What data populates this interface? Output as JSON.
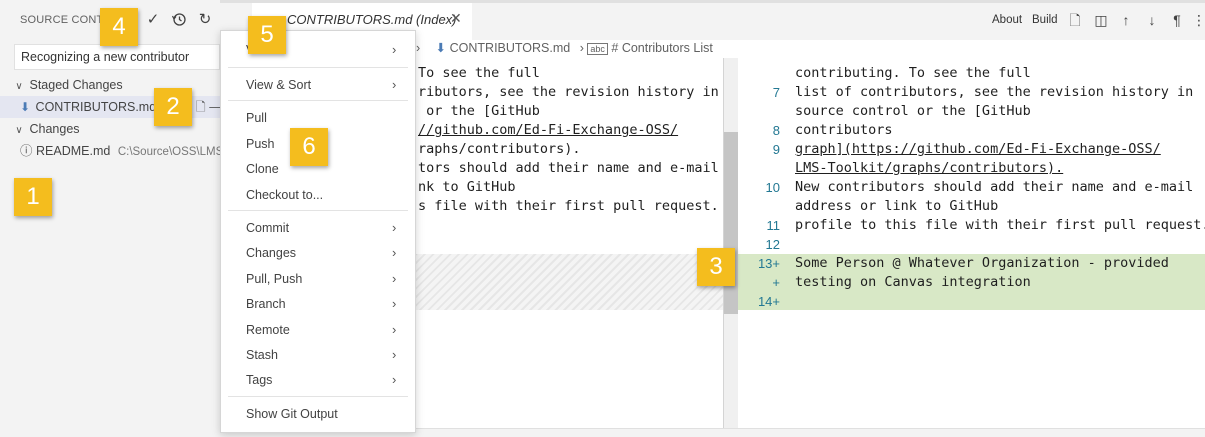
{
  "sidebar": {
    "title": "SOURCE CONTROL",
    "commit_message": "Recognizing a new contributor",
    "staged_group": "Staged Changes",
    "staged_file": "CONTRIBUTORS.md",
    "changes_group": "Changes",
    "changed_file": "README.md",
    "changed_file_path": "C:\\Source\\OSS\\LMS"
  },
  "tab": {
    "title": "CONTRIBUTORS.md (Index)"
  },
  "toolbar": {
    "about": "About",
    "build": "Build"
  },
  "breadcrumb": {
    "file": "CONTRIBUTORS.md",
    "symbol": "# Contributors List"
  },
  "left_editor": {
    "lines": [
      "To see the full",
      "ributors, see the revision history in",
      " or the [GitHub",
      "",
      "//github.com/Ed-Fi-Exchange-OSS/",
      "raphs/contributors).",
      "tors should add their name and e-mail",
      "nk to GitHub",
      "s file with their first pull request."
    ]
  },
  "right_editor": {
    "rows": [
      {
        "num": "",
        "text": "contributing. To see the full"
      },
      {
        "num": "7",
        "text": "list of contributors, see the revision history in"
      },
      {
        "num": "",
        "text": "source control or the [GitHub"
      },
      {
        "num": "8",
        "text": "contributors"
      },
      {
        "num": "9",
        "text": "graph](https://github.com/Ed-Fi-Exchange-OSS/"
      },
      {
        "num": "",
        "text": "LMS-Toolkit/graphs/contributors)."
      },
      {
        "num": "10",
        "text": "New contributors should add their name and e-mail"
      },
      {
        "num": "",
        "text": "address or link to GitHub"
      },
      {
        "num": "11",
        "text": "profile to this file with their first pull request."
      },
      {
        "num": "12",
        "text": ""
      },
      {
        "num": "13+",
        "text": "Some Person @ Whatever Organization - provided"
      },
      {
        "num": "+",
        "text": "testing on Canvas integration"
      },
      {
        "num": "14+",
        "text": ""
      }
    ]
  },
  "menu": {
    "items": [
      {
        "label": "Views",
        "submenu": true
      },
      {
        "label": "View & Sort",
        "submenu": true
      },
      {
        "label": "Pull",
        "submenu": false
      },
      {
        "label": "Push",
        "submenu": false
      },
      {
        "label": "Clone",
        "submenu": false
      },
      {
        "label": "Checkout to...",
        "submenu": false
      },
      {
        "label": "Commit",
        "submenu": true
      },
      {
        "label": "Changes",
        "submenu": true
      },
      {
        "label": "Pull, Push",
        "submenu": true
      },
      {
        "label": "Branch",
        "submenu": true
      },
      {
        "label": "Remote",
        "submenu": true
      },
      {
        "label": "Stash",
        "submenu": true
      },
      {
        "label": "Tags",
        "submenu": true
      },
      {
        "label": "Show Git Output",
        "submenu": false
      }
    ]
  },
  "callouts": [
    "1",
    "2",
    "3",
    "4",
    "5",
    "6"
  ],
  "icons": {
    "more": "more-actions-icon",
    "commit": "check-icon",
    "history": "history-icon",
    "refresh": "refresh-icon",
    "file": "markdown-file-icon",
    "info": "info-icon"
  },
  "colors": {
    "accent_callout": "#f4bd1e",
    "added_line_bg": "#d8e8c6",
    "sidebar_bg": "#f3f3f3",
    "line_number": "#237893"
  }
}
